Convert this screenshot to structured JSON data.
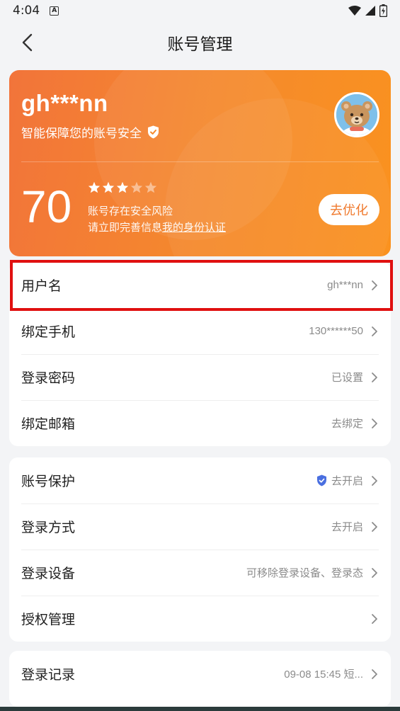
{
  "status_bar": {
    "time": "4:04",
    "notif_icon_letter": "A"
  },
  "nav": {
    "title": "账号管理",
    "back_icon": "chevron-left-icon"
  },
  "hero": {
    "username": "gh***nn",
    "subtitle": "智能保障您的账号安全",
    "score": "70",
    "stars": {
      "filled": 3,
      "total": 5
    },
    "risk_line1": "账号存在安全风险",
    "risk_line2_prefix": "请立即完善信息",
    "risk_line2_link": "我的身份认证",
    "optimize_button": "去优化",
    "colors": {
      "gradient_start": "#f2743a",
      "gradient_end": "#fa921f"
    }
  },
  "group1": [
    {
      "label": "用户名",
      "value": "gh***nn"
    },
    {
      "label": "绑定手机",
      "value": "130******50"
    },
    {
      "label": "登录密码",
      "value": "已设置"
    },
    {
      "label": "绑定邮箱",
      "value": "去绑定"
    }
  ],
  "group2": [
    {
      "label": "账号保护",
      "value": "去开启",
      "icon": "shield-check-icon"
    },
    {
      "label": "登录方式",
      "value": "去开启"
    },
    {
      "label": "登录设备",
      "value": "可移除登录设备、登录态"
    },
    {
      "label": "授权管理",
      "value": ""
    }
  ],
  "group3": [
    {
      "label": "登录记录",
      "value": "09-08 15:45 短..."
    }
  ],
  "highlight_color": "#e01010"
}
